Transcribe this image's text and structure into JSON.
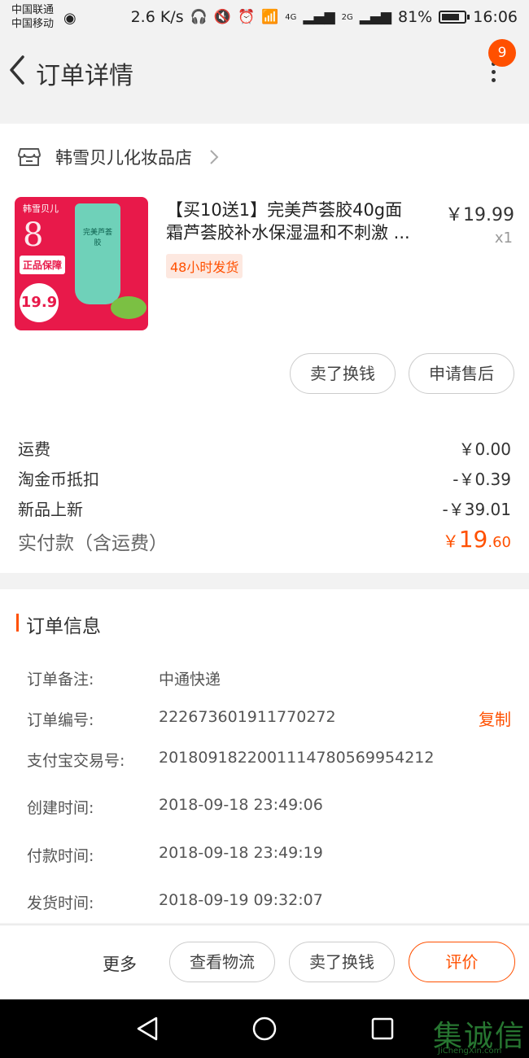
{
  "status_bar": {
    "carrier_1": "中国联通",
    "carrier_2": "中国移动",
    "net_speed": "2.6 K/s",
    "signal_1": "4G",
    "signal_2": "2G",
    "battery": "81%",
    "battery_level": 0.81,
    "time": "16:06"
  },
  "header": {
    "title": "订单详情",
    "badge_count": "9"
  },
  "shop": {
    "name": "韩雪贝儿化妆品店"
  },
  "product": {
    "title_line1": "【买10送1】完美芦荟胶40g面",
    "title_line2": "霜芦荟胶补水保湿温和不刺激 ...",
    "price": "￥19.99",
    "quantity": "x1",
    "tag": "48小时发货",
    "image": {
      "brand": "韩雪贝儿",
      "guarantee": "正品保障",
      "promo_price": "19.9",
      "tube_label": "完美芦荟胶"
    }
  },
  "item_actions": {
    "sell": "卖了换钱",
    "after_sale": "申请售后"
  },
  "fees": [
    {
      "label": "运费",
      "value": "￥0.00"
    },
    {
      "label": "淘金币抵扣",
      "value": "-￥0.39"
    },
    {
      "label": "新品上新",
      "value": "-￥39.01"
    }
  ],
  "total": {
    "label": "实付款（含运费）",
    "currency": "￥",
    "integer": "19",
    "decimal": ".60"
  },
  "order_info": {
    "title": "订单信息",
    "copy_label": "复制",
    "rows": [
      {
        "label": "订单备注:",
        "value": "中通快递"
      },
      {
        "label": "订单编号:",
        "value": "222673601911770272"
      },
      {
        "label": "支付宝交易号:",
        "value": "2018091822001114780569954212"
      },
      {
        "label": "创建时间:",
        "value": "2018-09-18 23:49:06"
      },
      {
        "label": "付款时间:",
        "value": "2018-09-18 23:49:19"
      },
      {
        "label": "发货时间:",
        "value": "2018-09-19 09:32:07"
      }
    ]
  },
  "bottom_bar": {
    "more": "更多",
    "logistics": "查看物流",
    "sell": "卖了换钱",
    "review": "评价"
  },
  "watermark": {
    "text": "集诚信",
    "sub": "JiChengXin.com"
  },
  "colors": {
    "accent": "#ff5000",
    "background": "#f2f2f2"
  }
}
